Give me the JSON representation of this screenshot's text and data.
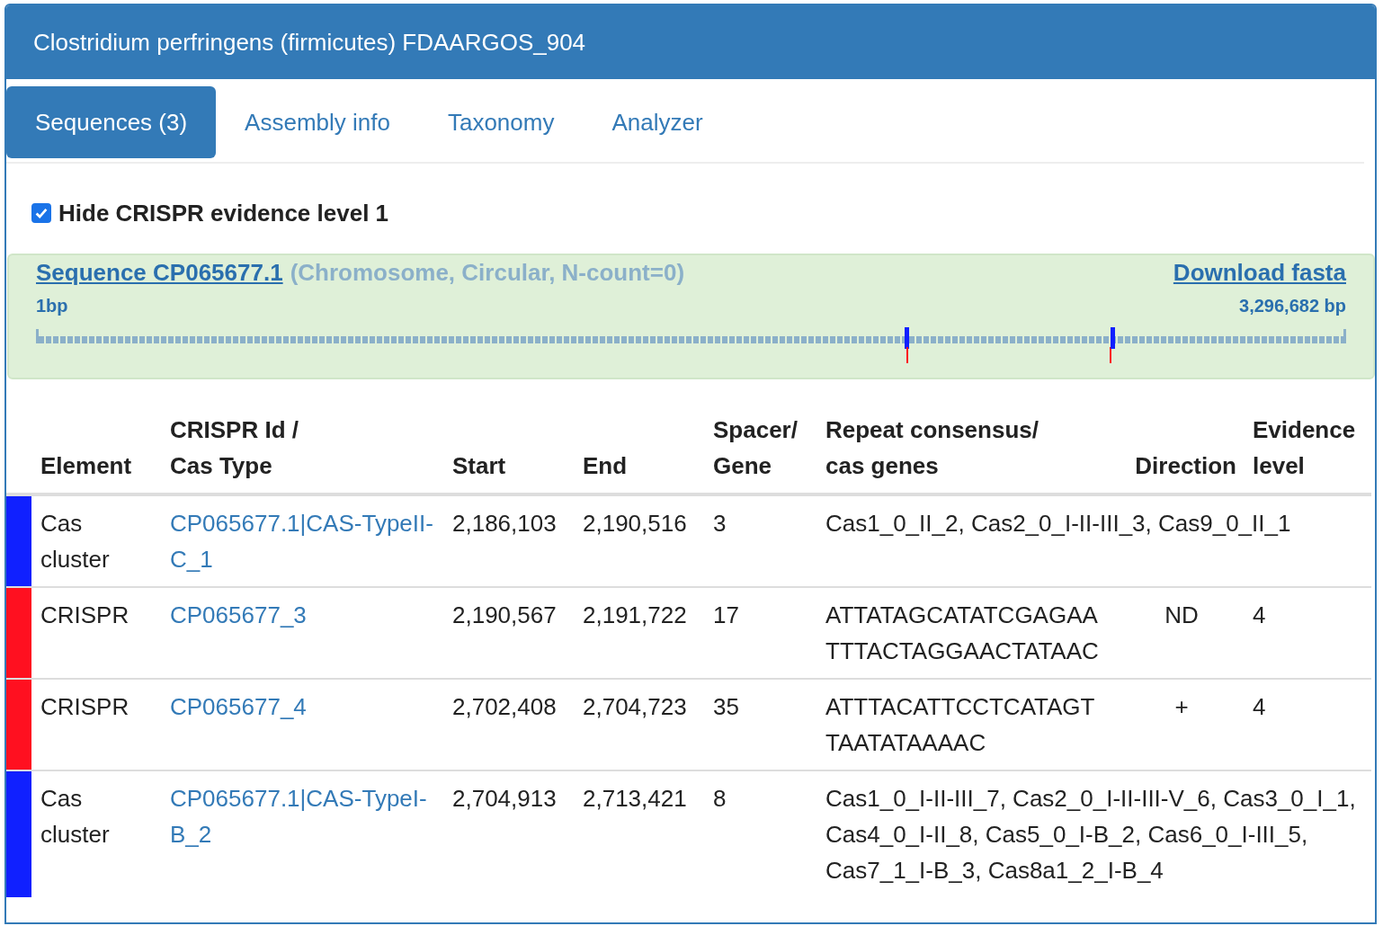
{
  "panel": {
    "title": "Clostridium perfringens (firmicutes) FDAARGOS_904"
  },
  "tabs": [
    {
      "label": "Sequences (3)",
      "selected": true
    },
    {
      "label": "Assembly info",
      "selected": false
    },
    {
      "label": "Taxonomy",
      "selected": false
    },
    {
      "label": "Analyzer",
      "selected": false
    }
  ],
  "filter": {
    "label": "Hide CRISPR evidence level 1",
    "checked": true
  },
  "sequence": {
    "link": "Sequence CP065677.1",
    "details": "(Chromosome, Circular, N-count=0)",
    "download": "Download fasta",
    "start_label": "1bp",
    "end_label": "3,296,682 bp"
  },
  "table": {
    "columns": [
      [
        "Element"
      ],
      [
        "CRISPR Id /",
        "Cas Type"
      ],
      [
        "Start"
      ],
      [
        "End"
      ],
      [
        "Spacer/",
        "Gene"
      ],
      [
        "Repeat consensus/",
        "cas genes"
      ],
      [
        "Direction"
      ],
      [
        "Evidence",
        "level"
      ]
    ],
    "rows": [
      {
        "kind": "cas",
        "color": "#1020ff",
        "element": "Cas cluster",
        "id": "CP065677.1|CAS-TypeII-C_1",
        "start": "2,186,103",
        "end": "2,190,516",
        "count": "3",
        "repeat": "Cas1_0_II_2, Cas2_0_I-II-III_3, Cas9_0_II_1"
      },
      {
        "kind": "crispr",
        "color": "#ff1020",
        "element": "CRISPR",
        "id": "CP065677_3",
        "start": "2,190,567",
        "end": "2,191,722",
        "count": "17",
        "repeat": "ATTATAGCATATCGAGAA TTTACTAGGAACTATAAC",
        "direction": "ND",
        "evidence": "4"
      },
      {
        "kind": "crispr",
        "color": "#ff1020",
        "element": "CRISPR",
        "id": "CP065677_4",
        "start": "2,702,408",
        "end": "2,704,723",
        "count": "35",
        "repeat": "ATTTACATTCCTCATAGT TAATATAAAAC",
        "direction": "+",
        "evidence": "4"
      },
      {
        "kind": "cas",
        "color": "#1020ff",
        "element": "Cas cluster",
        "id": "CP065677.1|CAS-TypeI-B_2",
        "start": "2,704,913",
        "end": "2,713,421",
        "count": "8",
        "repeat": "Cas1_0_I-II-III_7, Cas2_0_I-II-III-V_6, Cas3_0_I_1, Cas4_0_I-II_8, Cas5_0_I-B_2, Cas6_0_I-III_5, Cas7_1_I-B_3, Cas8a1_2_I-B_4"
      }
    ]
  }
}
